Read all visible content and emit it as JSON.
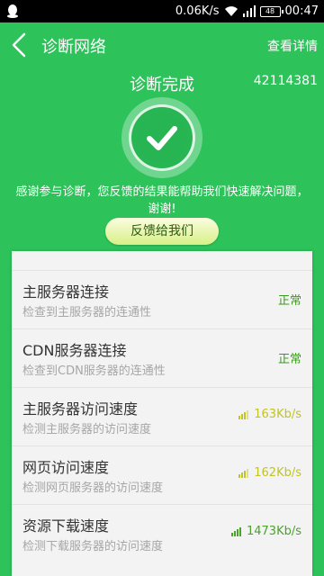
{
  "status_bar": {
    "speed": "0.06K/s",
    "signal": "..",
    "battery": "48",
    "time": "00:47"
  },
  "header": {
    "title": "诊断网络",
    "detail_label": "查看详情"
  },
  "result": {
    "status": "诊断完成",
    "code": "42114381",
    "thanks": "感谢参与诊断，您反馈的结果能帮助我们快速解决问题，谢谢!",
    "feedback_label": "反馈给我们"
  },
  "colors": {
    "header_green": "#2dc35a",
    "ok_green": "#3a9a1c",
    "speed_yellow": "#c2c324",
    "speed_green": "#4aa32b"
  },
  "checks": [
    {
      "title": "主服务器连接",
      "desc": "检查到主服务器的连通性",
      "result": "正常"
    },
    {
      "title": "CDN服务器连接",
      "desc": "检查到CDN服务器的连通性",
      "result": "正常"
    },
    {
      "title": "主服务器访问速度",
      "desc": "检测主服务器的访问速度",
      "result": "163Kb/s"
    },
    {
      "title": "网页访问速度",
      "desc": "检测网页服务器的访问速度",
      "result": "162Kb/s"
    },
    {
      "title": "资源下载速度",
      "desc": "检测下载服务器的访问速度",
      "result": "1473Kb/s"
    }
  ]
}
